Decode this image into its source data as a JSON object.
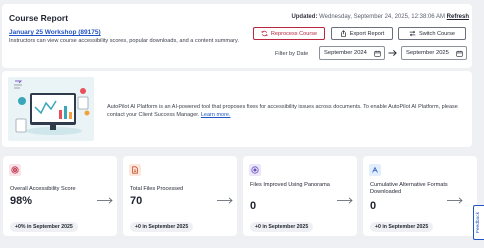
{
  "header": {
    "title": "Course Report",
    "course_link": "January 25 Workshop (89175)",
    "description": "Instructors can view course accessibility scores, popular downloads, and a content summary.",
    "updated_label": "Updated:",
    "updated_value": "Wednesday, September 24, 2025, 12:38:06 AM",
    "refresh_label": "Refresh",
    "buttons": {
      "reprocess": "Reprocess Course",
      "export": "Export Report",
      "switch": "Switch Course"
    },
    "filter_label": "Filter by Date",
    "date_from": "September 2024",
    "date_to": "September 2025"
  },
  "banner": {
    "text": "AutoPilot AI Platform is an AI-powered tool that proposes fixes for accessibility issues across documents. To enable AutoPilot AI Platform, please contact your Client Success Manager.",
    "link": "Learn more."
  },
  "metrics": [
    {
      "label": "Overall Accessibility Score",
      "value": "98%",
      "change": "+0% in September 2025",
      "icon": "target-icon"
    },
    {
      "label": "Total Files Processed",
      "value": "70",
      "change": "+0 in September 2025",
      "icon": "document-icon"
    },
    {
      "label": "Files Improved Using Panorama",
      "value": "0",
      "change": "+0 in September 2025",
      "icon": "panorama-icon"
    },
    {
      "label": "Cumulative Alternative Formats Downloaded",
      "value": "0",
      "change": "+0 in September 2025",
      "icon": "alt-format-icon"
    }
  ],
  "feedback_label": "Feedback",
  "colors": {
    "accent_red": "#b8263f",
    "link_blue": "#2354c3",
    "tile_pink": "#fbe3ea",
    "tile_peach": "#fde6dc",
    "tile_lavender": "#ece6f9",
    "tile_blue": "#e2eefc"
  }
}
